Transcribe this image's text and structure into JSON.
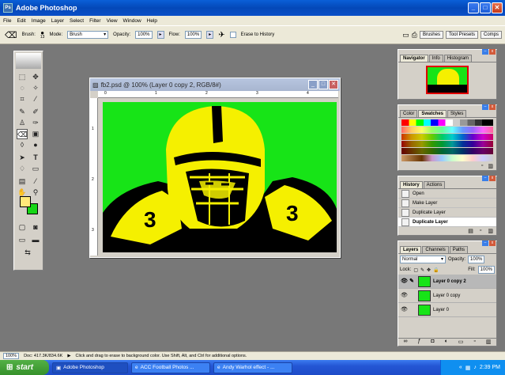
{
  "app": {
    "title": "Adobe Photoshop"
  },
  "menu": [
    "File",
    "Edit",
    "Image",
    "Layer",
    "Select",
    "Filter",
    "View",
    "Window",
    "Help"
  ],
  "options": {
    "brush_label": "Brush:",
    "brush_size": "13",
    "mode_label": "Mode:",
    "mode_value": "Brush",
    "opacity_label": "Opacity:",
    "opacity_value": "100%",
    "flow_label": "Flow:",
    "flow_value": "100%",
    "erase_history": "Erase to History",
    "wells": [
      "Brushes",
      "Tool Presets",
      "Comps"
    ]
  },
  "document": {
    "title": "fb2.psd @ 100% (Layer 0 copy 2, RGB/8#)",
    "ruler_h": [
      "0",
      "1",
      "2",
      "3",
      "4"
    ],
    "ruler_v": [
      "1",
      "2",
      "3"
    ]
  },
  "navigator": {
    "tabs": [
      "Navigator",
      "Info",
      "Histogram"
    ]
  },
  "swatches": {
    "tabs": [
      "Color",
      "Swatches",
      "Styles"
    ]
  },
  "history": {
    "tabs": [
      "History",
      "Actions"
    ],
    "items": [
      "Open",
      "Make Layer",
      "Duplicate Layer",
      "Duplicate Layer"
    ]
  },
  "layers": {
    "tabs": [
      "Layers",
      "Channels",
      "Paths"
    ],
    "blend_mode": "Normal",
    "opacity_label": "Opacity:",
    "opacity_value": "100%",
    "lock_label": "Lock:",
    "fill_label": "Fill:",
    "fill_value": "100%",
    "items": [
      "Layer 0 copy 2",
      "Layer 0 copy",
      "Layer 0"
    ]
  },
  "status": {
    "zoom": "100%",
    "doc": "Doc: 417.3K/834.6K",
    "hint": "Click and drag to erase to background color. Use Shift, Alt, and Ctrl for additional options."
  },
  "taskbar": {
    "start": "start",
    "tasks": [
      "Adobe Photoshop",
      "ACC Football Photos ...",
      "Andy Warhol effect - ..."
    ],
    "clock": "2:39 PM"
  },
  "colors": {
    "foreground": "#ffe97a",
    "background": "#16d616",
    "canvas_green": "#17e417",
    "canvas_yellow": "#f5f000"
  }
}
